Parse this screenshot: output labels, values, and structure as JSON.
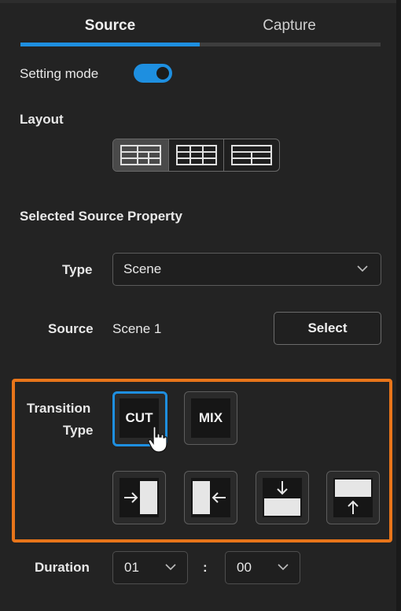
{
  "tabs": [
    {
      "label": "Source",
      "active": true
    },
    {
      "label": "Capture",
      "active": false
    }
  ],
  "setting_mode": {
    "label": "Setting mode",
    "on": true
  },
  "layout": {
    "heading": "Layout",
    "options": [
      "grid-layout-1-icon",
      "grid-layout-2-icon",
      "grid-layout-3-icon"
    ],
    "selected_index": 0
  },
  "source_property": {
    "heading": "Selected Source Property",
    "type_label": "Type",
    "type_value": "Scene",
    "source_label": "Source",
    "source_value": "Scene 1",
    "select_button": "Select"
  },
  "transition": {
    "label_line1": "Transition",
    "label_line2": "Type",
    "cut": "CUT",
    "mix": "MIX",
    "selected": "CUT",
    "wipes": [
      "wipe-right-icon",
      "wipe-left-icon",
      "wipe-down-icon",
      "wipe-up-icon"
    ]
  },
  "duration": {
    "label": "Duration",
    "minutes": "01",
    "separator": ":",
    "seconds": "00"
  },
  "colors": {
    "accent": "#1e8fe0",
    "highlight_frame": "#e8751a",
    "background": "#232323"
  }
}
